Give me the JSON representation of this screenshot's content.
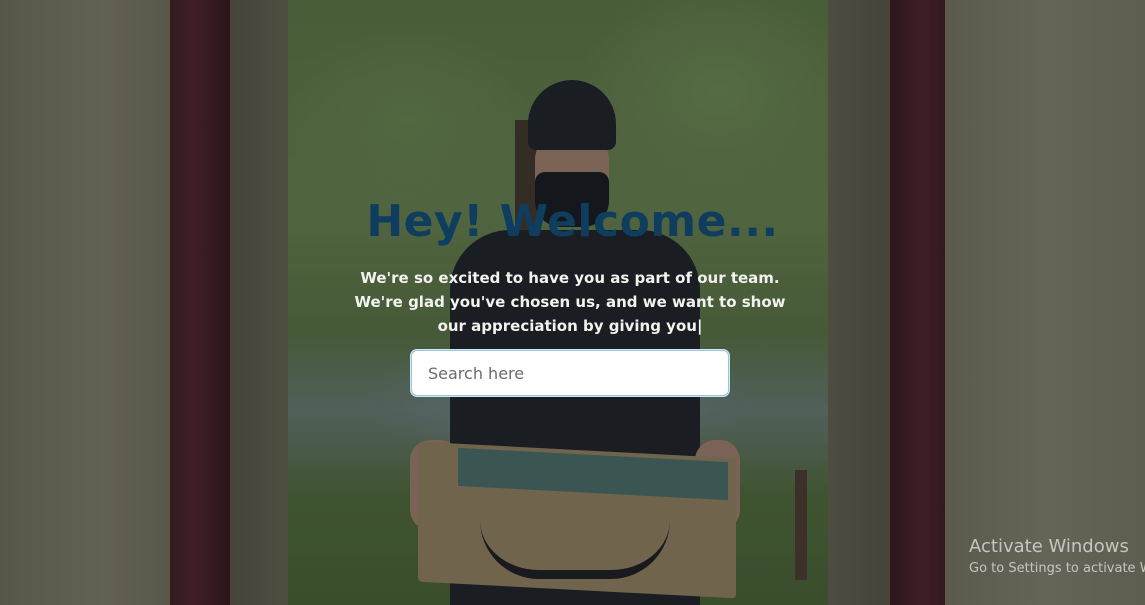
{
  "hero": {
    "title": "Hey! Welcome...",
    "message": "We're so excited to have you as part of our team. We're glad you've chosen us, and we want to show our appreciation by giving you|"
  },
  "search": {
    "placeholder": "Search here",
    "value": ""
  },
  "background": {
    "description_icon": "delivery-person-photo",
    "overlay_color": "#14181e"
  },
  "colors": {
    "title": "#0f3d5f",
    "message": "#f2f2ee",
    "search_border": "#9bc6de"
  },
  "watermark": {
    "title": "Activate Windows",
    "subtitle": "Go to Settings to activate Windows."
  }
}
